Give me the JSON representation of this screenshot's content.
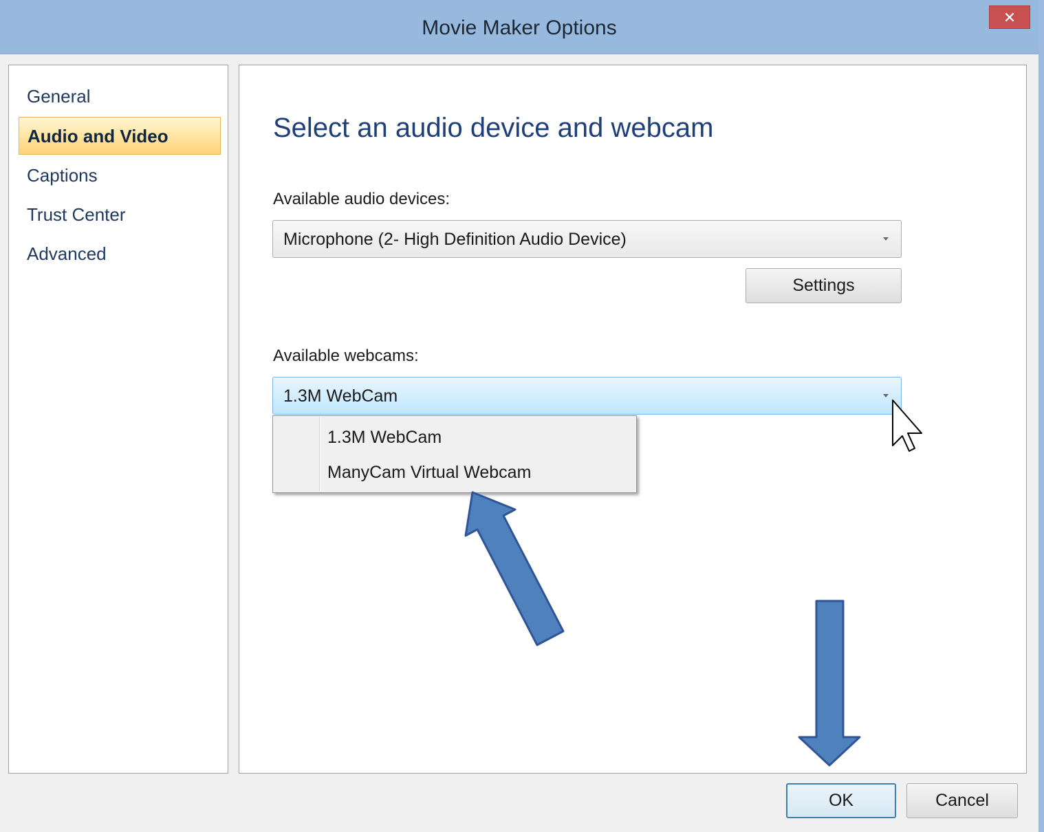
{
  "window": {
    "title": "Movie Maker Options",
    "close_glyph": "✕"
  },
  "sidebar": {
    "items": [
      {
        "label": "General"
      },
      {
        "label": "Audio and Video",
        "selected": true
      },
      {
        "label": "Captions"
      },
      {
        "label": "Trust Center"
      },
      {
        "label": "Advanced"
      }
    ]
  },
  "main": {
    "heading": "Select an audio device and webcam",
    "audio": {
      "label": "Available audio devices:",
      "selected": "Microphone (2- High Definition Audio Device)",
      "settings_label": "Settings"
    },
    "webcam": {
      "label": "Available webcams:",
      "selected": "1.3M WebCam",
      "options": [
        "1.3M WebCam",
        "ManyCam Virtual Webcam"
      ],
      "dropdown_open": true
    }
  },
  "footer": {
    "ok_label": "OK",
    "cancel_label": "Cancel"
  },
  "colors": {
    "titlebar": "#98b9de",
    "close_button": "#c75050",
    "selection_highlight": "#ffd27a",
    "heading": "#1e3f78",
    "annotation_arrow": "#4f81bd",
    "annotation_arrow_outline": "#2f5597"
  },
  "icons": [
    "close-icon",
    "dropdown-arrow-icon",
    "mouse-cursor-icon",
    "annotation-arrow-icon"
  ]
}
